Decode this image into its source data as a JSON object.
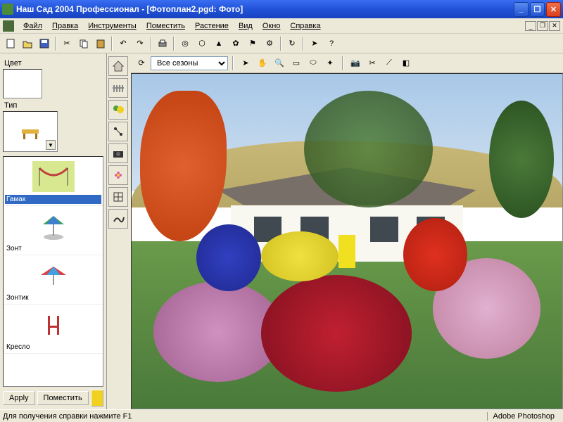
{
  "app": {
    "title": "Наш Сад 2004 Профессионал - [Фотоплан2.pgd: Фото]"
  },
  "menu": {
    "file": "Файл",
    "edit": "Правка",
    "tools": "Инструменты",
    "place": "Поместить",
    "plant": "Растение",
    "view": "Вид",
    "window": "Окно",
    "help": "Справка"
  },
  "panel": {
    "color_label": "Цвет",
    "type_label": "Тип",
    "items": [
      {
        "label": "Гамак",
        "selected": true
      },
      {
        "label": "Зонт",
        "selected": false
      },
      {
        "label": "Зонтик",
        "selected": false
      },
      {
        "label": "Кресло",
        "selected": false
      }
    ],
    "apply": "Apply",
    "place_btn": "Поместить"
  },
  "canvas": {
    "season_dropdown": "Все сезоны"
  },
  "status": {
    "help_text": "Для получения справки нажмите F1",
    "right_text": "Adobe Photoshop"
  },
  "tool_icons": [
    "house-icon",
    "fence-icon",
    "plant-group-icon",
    "connector-icon",
    "camera-icon",
    "flower-icon",
    "grid-icon",
    "hand-draw-icon"
  ],
  "canvas_tools": [
    "arrow-icon",
    "hand-icon",
    "zoom-icon",
    "marquee-icon",
    "lasso-icon",
    "wand-icon",
    "camera-tool-icon",
    "scissors-icon",
    "eyedropper-icon",
    "adjust-icon"
  ]
}
